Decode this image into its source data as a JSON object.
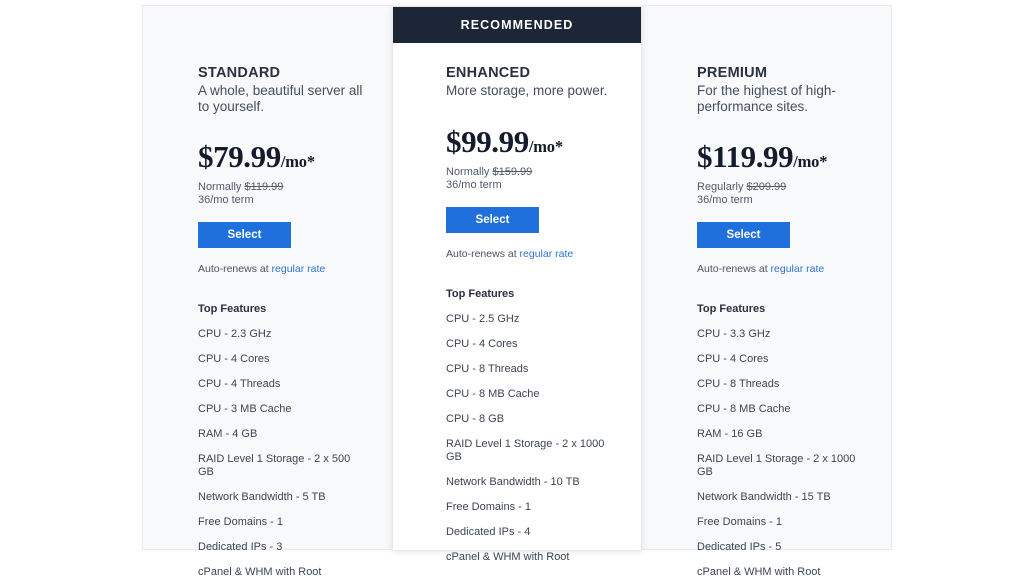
{
  "page": {
    "background": "#ffffff",
    "accent_blue": "#1f6fdd",
    "link_blue": "#2f74d0",
    "banner_navy": "#1d2636",
    "heading_color": "#2a3042"
  },
  "plans": [
    {
      "id": "standard",
      "name": "STANDARD",
      "description": "A whole, beautiful server all to yourself.",
      "price": "$79.99",
      "price_unit": "/mo*",
      "normally_label": "Normally",
      "normally_price": "$119.99",
      "term": "36/mo term",
      "select_label": "Select",
      "autorenew_prefix": "Auto-renews at ",
      "autorenew_link": "regular rate",
      "features_title": "Top Features",
      "features": [
        "CPU - 2.3 GHz",
        "CPU - 4 Cores",
        "CPU - 4 Threads",
        "CPU - 3 MB Cache",
        "RAM - 4 GB",
        "RAID Level 1 Storage - 2 x 500 GB",
        "Network Bandwidth - 5 TB",
        "Free Domains - 1",
        "Dedicated IPs - 3",
        "cPanel & WHM with Root"
      ],
      "recommended": false,
      "badge_label": ""
    },
    {
      "id": "enhanced",
      "name": "ENHANCED",
      "description": "More storage, more power.",
      "price": "$99.99",
      "price_unit": "/mo*",
      "normally_label": "Normally",
      "normally_price": "$159.99",
      "term": "36/mo term",
      "select_label": "Select",
      "autorenew_prefix": "Auto-renews at ",
      "autorenew_link": "regular rate",
      "features_title": "Top Features",
      "features": [
        "CPU - 2.5 GHz",
        "CPU - 4 Cores",
        "CPU - 8 Threads",
        "CPU - 8 MB Cache",
        "CPU - 8 GB",
        "RAID Level 1 Storage - 2 x 1000 GB",
        "Network Bandwidth - 10 TB",
        "Free Domains - 1",
        "Dedicated IPs - 4",
        "cPanel & WHM with Root"
      ],
      "recommended": true,
      "badge_label": "RECOMMENDED"
    },
    {
      "id": "premium",
      "name": "PREMIUM",
      "description": "For the highest of high-performance sites.",
      "price": "$119.99",
      "price_unit": "/mo*",
      "normally_label": "Regularly",
      "normally_price": "$209.99",
      "term": "36/mo term",
      "select_label": "Select",
      "autorenew_prefix": "Auto-renews at ",
      "autorenew_link": "regular rate",
      "features_title": "Top Features",
      "features": [
        "CPU - 3.3 GHz",
        "CPU - 4 Cores",
        "CPU - 8 Threads",
        "CPU - 8 MB Cache",
        "RAM - 16 GB",
        "RAID Level 1 Storage - 2 x 1000 GB",
        "Network Bandwidth - 15 TB",
        "Free Domains - 1",
        "Dedicated IPs - 5",
        "cPanel & WHM with Root"
      ],
      "recommended": false,
      "badge_label": ""
    }
  ]
}
